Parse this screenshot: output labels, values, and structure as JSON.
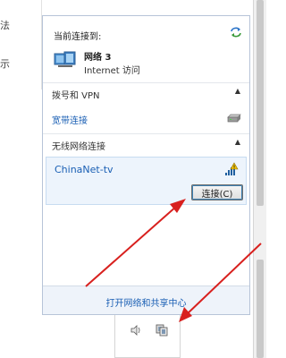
{
  "background": {
    "left_fragment_1": "法",
    "left_fragment_2": "示"
  },
  "flyout": {
    "current_label": "当前连接到:",
    "refresh_icon": "refresh-arrows-icon",
    "network": {
      "name": "网络  3",
      "access": "Internet 访问",
      "icon": "network-monitor-icon"
    },
    "dial_section": {
      "label": "拨号和 VPN",
      "collapse_icon": "caret-up-icon"
    },
    "broadband": {
      "label": "宽带连接",
      "icon": "modem-icon"
    },
    "wireless_section": {
      "label": "无线网络连接",
      "collapse_icon": "caret-up-icon"
    },
    "wifi": {
      "ssid": "ChinaNet-tv",
      "icon": "wifi-signal-unsecured-icon",
      "connect_label": "连接(C)"
    },
    "footer_link": "打开网络和共享中心"
  },
  "tray": {
    "icons": [
      "speaker-icon",
      "network-tray-icon"
    ]
  },
  "colors": {
    "link_blue": "#1a5fb4",
    "selected_bg": "#edf4fc",
    "footer_bg": "#eef3fa",
    "annotation_red": "#d8201e"
  }
}
